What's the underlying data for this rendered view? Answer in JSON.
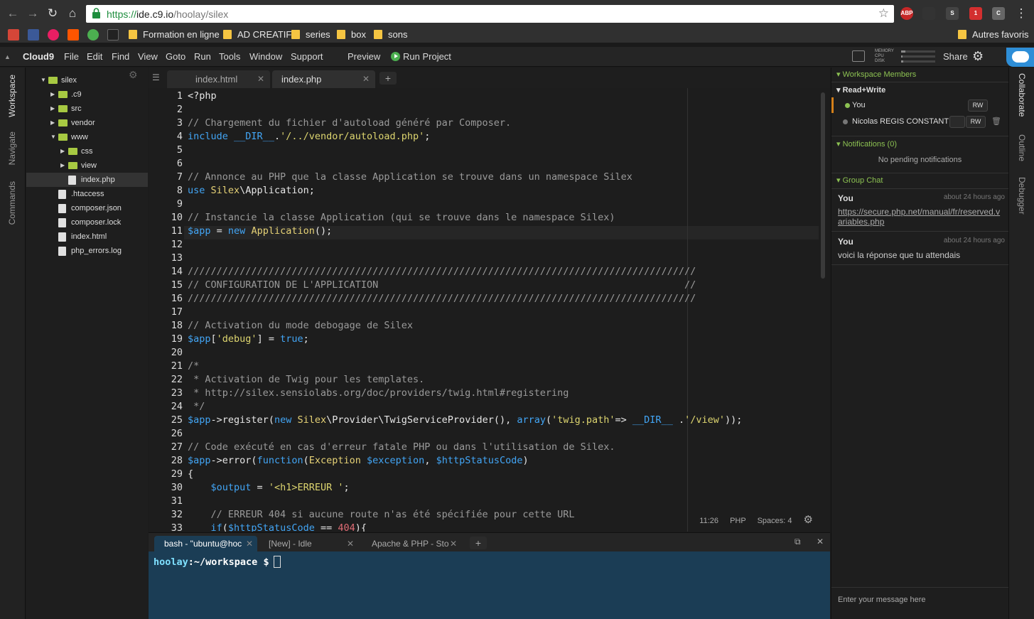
{
  "browser": {
    "url_scheme": "https://",
    "url_host": "ide.c9.io",
    "url_path": "/hoolay/silex",
    "extensions": [
      "ABP",
      "S",
      "1",
      "C"
    ]
  },
  "bookmarks": [
    {
      "label": "Formation en ligne"
    },
    {
      "label": "AD CREATIF"
    },
    {
      "label": "series"
    },
    {
      "label": "box"
    },
    {
      "label": "sons"
    }
  ],
  "bookmarks_other": "Autres favoris",
  "menubar": {
    "brand": "Cloud9",
    "items": [
      "File",
      "Edit",
      "Find",
      "View",
      "Goto",
      "Run",
      "Tools",
      "Window",
      "Support"
    ],
    "preview": "Preview",
    "run_project": "Run Project",
    "meters": {
      "memory": "MEMORY",
      "cpu": "CPU",
      "disk": "DISK",
      "memory_level": 0.12,
      "cpu_level": 0.04,
      "disk_level": 0.06
    },
    "share": "Share"
  },
  "left_tabs": [
    "Workspace",
    "Navigate",
    "Commands"
  ],
  "tree": [
    {
      "label": "silex",
      "type": "folder",
      "open": true,
      "depth": 0
    },
    {
      "label": ".c9",
      "type": "folder",
      "open": false,
      "depth": 1
    },
    {
      "label": "src",
      "type": "folder",
      "open": false,
      "depth": 1
    },
    {
      "label": "vendor",
      "type": "folder",
      "open": false,
      "depth": 1
    },
    {
      "label": "www",
      "type": "folder",
      "open": true,
      "depth": 1
    },
    {
      "label": "css",
      "type": "folder",
      "open": false,
      "depth": 2
    },
    {
      "label": "view",
      "type": "folder",
      "open": false,
      "depth": 2
    },
    {
      "label": "index.php",
      "type": "file",
      "depth": 2,
      "selected": true
    },
    {
      "label": ".htaccess",
      "type": "file",
      "depth": 1
    },
    {
      "label": "composer.json",
      "type": "file",
      "depth": 1
    },
    {
      "label": "composer.lock",
      "type": "file",
      "depth": 1
    },
    {
      "label": "index.html",
      "type": "file",
      "depth": 1
    },
    {
      "label": "php_errors.log",
      "type": "file",
      "depth": 1
    }
  ],
  "editor_tabs": [
    {
      "label": "index.html",
      "active": false
    },
    {
      "label": "index.php",
      "active": true
    }
  ],
  "code_lines": [
    "<?php",
    "",
    "// Chargement du fichier d'autoload généré par Composer.",
    "include __DIR__.'/../vendor/autoload.php';",
    "",
    "",
    "// Annonce au PHP que la classe Application se trouve dans un namespace Silex",
    "use Silex\\Application;",
    "",
    "// Instancie la classe Application (qui se trouve dans le namespace Silex)",
    "$app = new Application();",
    "",
    "",
    "////////////////////////////////////////////////////////////////////////////////////////",
    "// CONFIGURATION DE L'APPLICATION                                                     //",
    "////////////////////////////////////////////////////////////////////////////////////////",
    "",
    "// Activation du mode debogage de Silex",
    "$app['debug'] = true;",
    "",
    "/*",
    " * Activation de Twig pour les templates.",
    " * http://silex.sensiolabs.org/doc/providers/twig.html#registering",
    " */",
    "$app->register(new Silex\\Provider\\TwigServiceProvider(), array('twig.path'=> __DIR__ .'/view'));",
    "",
    "// Code exécuté en cas d'erreur fatale PHP ou dans l'utilisation de Silex.",
    "$app->error(function(Exception $exception, $httpStatusCode)",
    "{",
    "    $output = '<h1>ERREUR ';",
    "",
    "    // ERREUR 404 si aucune route n'as été spécifiée pour cette URL",
    "    if($httpStatusCode == 404){"
  ],
  "status": {
    "cursor": "11:26",
    "language": "PHP",
    "spaces": "Spaces: 4"
  },
  "terminal_tabs": [
    {
      "label": "bash - \"ubuntu@hoc",
      "active": true
    },
    {
      "label": "[New] - Idle",
      "active": false
    },
    {
      "label": "Apache & PHP - Sto",
      "active": false
    }
  ],
  "terminal": {
    "user": "hoolay",
    "path": ":~/workspace",
    "prompt": " $"
  },
  "right_panel": {
    "workspace_members": "Workspace Members",
    "read_write": "Read+Write",
    "members": [
      {
        "name": "You",
        "perm": "RW",
        "online": true
      },
      {
        "name": "Nicolas REGIS CONSTANT",
        "perm": "RW",
        "online": false
      }
    ],
    "notifications": "Notifications (0)",
    "no_notifications": "No pending notifications",
    "group_chat": "Group Chat",
    "messages": [
      {
        "who": "You",
        "when": "about 24 hours ago",
        "text": "https://secure.php.net/manual/fr/reserved.variables.php",
        "is_link": true
      },
      {
        "who": "You",
        "when": "about 24 hours ago",
        "text": "voici la réponse que tu attendais",
        "is_link": false
      }
    ],
    "chat_placeholder": "Enter your message here"
  },
  "right_tabs": [
    "Collaborate",
    "Outline",
    "Debugger"
  ],
  "colors": {
    "accent": "#2e8ed7",
    "terminal_bg": "#1b3d55",
    "folder": "#a7c942"
  }
}
